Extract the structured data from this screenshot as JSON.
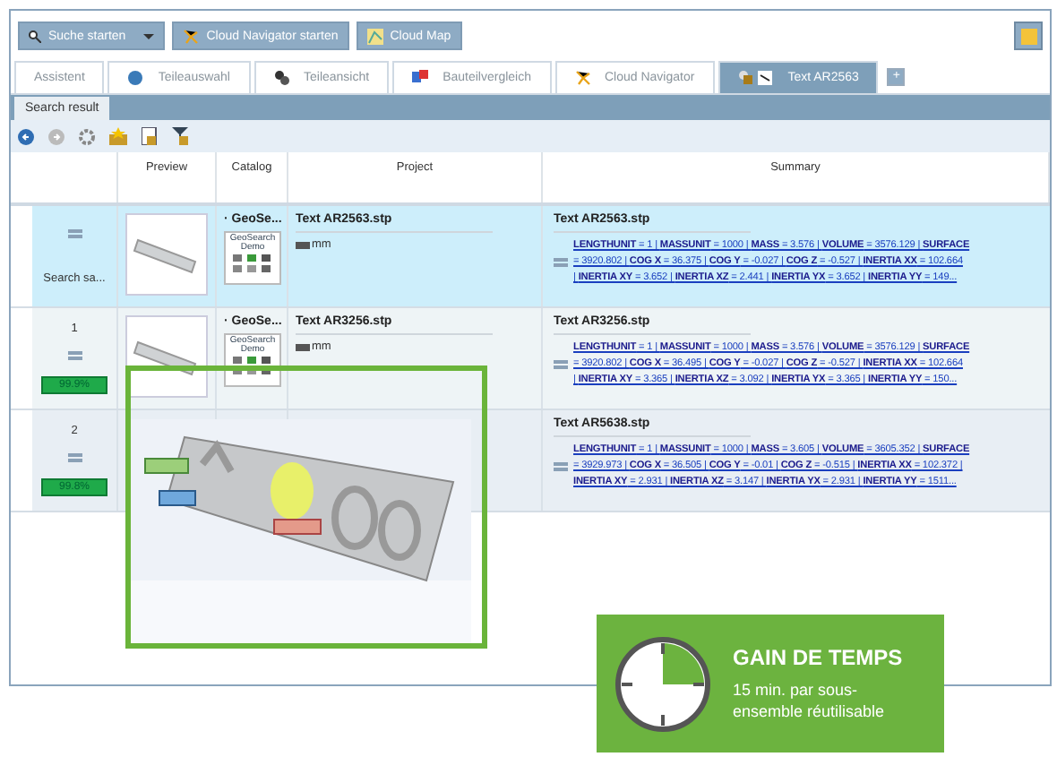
{
  "toolbar": {
    "buttons": [
      {
        "label": "Suche starten",
        "kind": "search"
      },
      {
        "label": "Cloud Navigator starten",
        "kind": "cloud"
      },
      {
        "label": "Cloud Map",
        "kind": "map"
      }
    ]
  },
  "tabs": [
    {
      "label": "Assistent",
      "kind": "plain",
      "selected": false
    },
    {
      "label": "Teileauswahl",
      "kind": "globe",
      "selected": false
    },
    {
      "label": "Teileansicht",
      "kind": "gears",
      "selected": false
    },
    {
      "label": "Bauteilvergleich",
      "kind": "compare",
      "selected": false
    },
    {
      "label": "Cloud Navigator",
      "kind": "network",
      "selected": false
    },
    {
      "label": "Text AR2563",
      "kind": "part",
      "selected": true
    }
  ],
  "add_tab": "+",
  "panel_tab": "Search result",
  "table": {
    "columns": [
      "Preview",
      "Catalog",
      "Project",
      "Summary"
    ],
    "rows": [
      {
        "selected": true,
        "rank_label": "Search sa...",
        "catalog": "· GeoSe...",
        "catalog_logo": "GeoSearch Demo",
        "project": "Text AR2563.stp",
        "unit": "mm",
        "summary_title": "Text AR2563.stp",
        "summary": [
          "**LENGTHUNIT** = 1 | **MASSUNIT** = 1000 | **MASS** = 3.576 | **VOLUME** = 3576.129 | **SURFACE**",
          "= 3920.802 | **COG X** = 36.375 | **COG Y** = -0.027 | **COG Z** = -0.527 | **INERTIA XX** = 102.664",
          "| **INERTIA XY** = 3.652 | **INERTIA XZ** = 2.441 | **INERTIA YX** = 3.652 | **INERTIA YY** = 149..."
        ]
      },
      {
        "selected": false,
        "rank": "1",
        "score": "99.9%",
        "catalog": "· GeoSe...",
        "catalog_logo": "GeoSearch Demo",
        "project": "Text AR3256.stp",
        "unit": "mm",
        "summary_title": "Text AR3256.stp",
        "summary": [
          "**LENGTHUNIT** = 1 | **MASSUNIT** = 1000 | **MASS** = 3.576 | **VOLUME** = 3576.129 | **SURFACE**",
          "= 3920.802 | **COG X** = 36.495 | **COG Y** = -0.027 | **COG Z** = -0.527 | **INERTIA XX** = 102.664",
          "| **INERTIA XY** = 3.365 | **INERTIA XZ** = 3.092 | **INERTIA YX** = 3.365 | **INERTIA YY** = 150..."
        ]
      },
      {
        "selected": false,
        "rank": "2",
        "score": "99.8%",
        "summary_title": "Text AR5638.stp",
        "summary": [
          "**LENGTHUNIT** = 1 | **MASSUNIT** = 1000 | **MASS** = 3.605 | **VOLUME** = 3605.352 | **SURFACE**",
          "= 3929.973 | **COG X** = 36.505 | **COG Y** = -0.01 | **COG Z** = -0.515 | **INERTIA XX** = 102.372 |",
          "**INERTIA XY** = 2.931 | **INERTIA XZ** = 3.147 | **INERTIA YX** = 2.931 | **INERTIA YY** = 1511..."
        ]
      }
    ]
  },
  "badge": {
    "title": "GAIN DE TEMPS",
    "text": "15 min. par sous-ensemble réutilisable"
  }
}
